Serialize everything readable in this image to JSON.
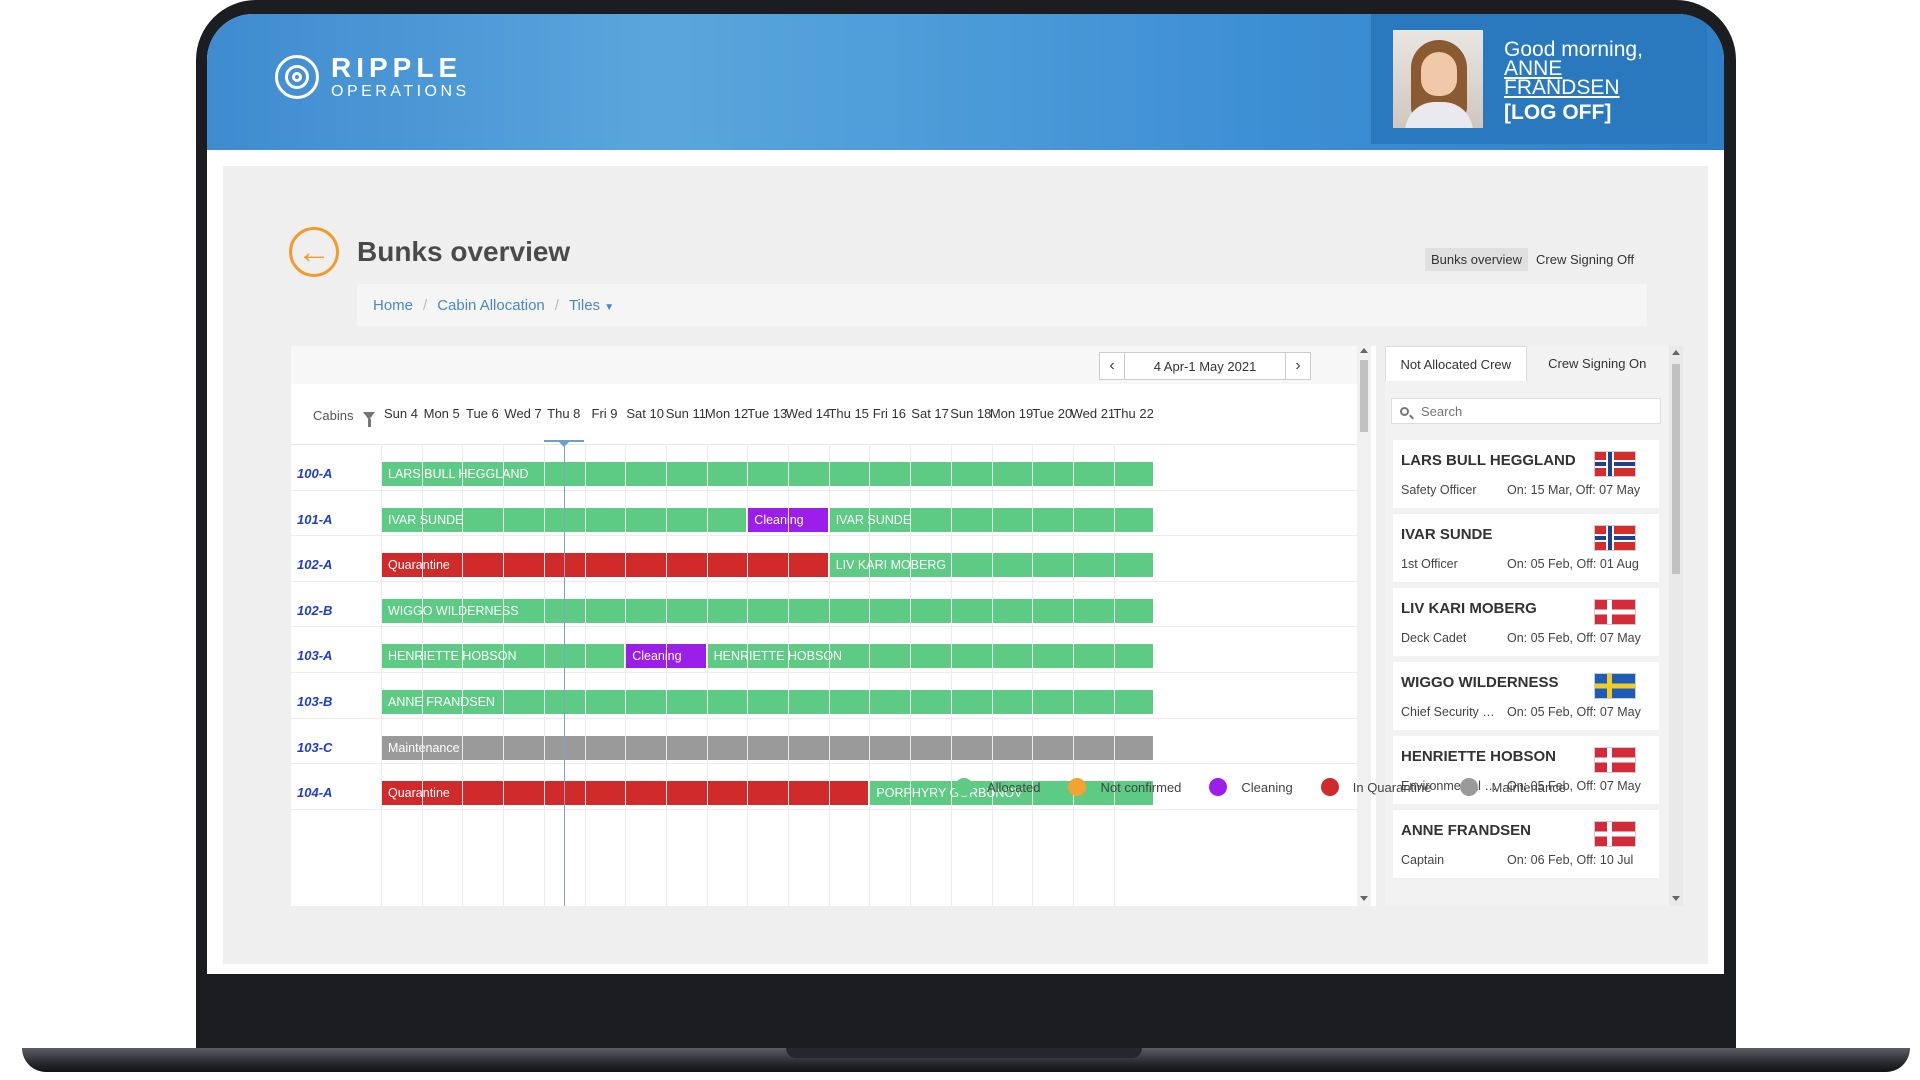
{
  "colors": {
    "allocated": "#5dcb84",
    "not_confirmed": "#f5a233",
    "cleaning": "#9c1eea",
    "quarantine": "#d12a2a",
    "maintenance": "#9a9a9a",
    "accent": "#f39a2c"
  },
  "header": {
    "logo_name": "RIPPLE",
    "logo_sub": "OPERATIONS",
    "greeting": "Good morning,",
    "user_first": "ANNE",
    "user_last": "FRANDSEN",
    "logoff": "[LOG OFF]"
  },
  "page": {
    "title": "Bunks overview",
    "top_links": [
      "Bunks overview",
      "Crew Signing Off"
    ],
    "breadcrumb": [
      "Home",
      "Cabin Allocation",
      "Tiles"
    ]
  },
  "calendar": {
    "range": "4 Apr-1 May 2021",
    "cabins_label": "Cabins",
    "days": [
      "Sun 4",
      "Mon 5",
      "Tue 6",
      "Wed 7",
      "Thu 8",
      "Fri 9",
      "Sat 10",
      "Sun 11",
      "Mon 12",
      "Tue 13",
      "Wed 14",
      "Thu 15",
      "Fri 16",
      "Sat 17",
      "Sun 18",
      "Mon 19",
      "Tue 20",
      "Wed 21",
      "Thu 22"
    ],
    "today_index": 4,
    "rows": [
      {
        "cabin": "100-A",
        "bars": [
          {
            "label": "LARS BULL HEGGLAND",
            "status": "allocated",
            "start": 0,
            "end": 19
          }
        ]
      },
      {
        "cabin": "101-A",
        "bars": [
          {
            "label": "IVAR SUNDE",
            "status": "allocated",
            "start": 0,
            "end": 9
          },
          {
            "label": "Cleaning",
            "status": "cleaning",
            "start": 9,
            "end": 11
          },
          {
            "label": "IVAR SUNDE",
            "status": "allocated",
            "start": 11,
            "end": 19
          }
        ]
      },
      {
        "cabin": "102-A",
        "bars": [
          {
            "label": "Quarantine",
            "status": "quarantine",
            "start": 0,
            "end": 11
          },
          {
            "label": "LIV KARI MOBERG",
            "status": "allocated",
            "start": 11,
            "end": 19
          }
        ]
      },
      {
        "cabin": "102-B",
        "bars": [
          {
            "label": "WIGGO WILDERNESS",
            "status": "allocated",
            "start": 0,
            "end": 19
          }
        ]
      },
      {
        "cabin": "103-A",
        "bars": [
          {
            "label": "HENRIETTE HOBSON",
            "status": "allocated",
            "start": 0,
            "end": 6
          },
          {
            "label": "Cleaning",
            "status": "cleaning",
            "start": 6,
            "end": 8
          },
          {
            "label": "HENRIETTE HOBSON",
            "status": "allocated",
            "start": 8,
            "end": 19
          }
        ]
      },
      {
        "cabin": "103-B",
        "bars": [
          {
            "label": "ANNE FRANDSEN",
            "status": "allocated",
            "start": 0,
            "end": 19
          }
        ]
      },
      {
        "cabin": "103-C",
        "bars": [
          {
            "label": "Maintenance",
            "status": "maintenance",
            "start": 0,
            "end": 19
          }
        ]
      },
      {
        "cabin": "104-A",
        "bars": [
          {
            "label": "Quarantine",
            "status": "quarantine",
            "start": 0,
            "end": 12
          },
          {
            "label": "PORPHYRY GORBUNOV",
            "status": "allocated",
            "start": 12,
            "end": 19
          }
        ]
      }
    ]
  },
  "crew_panel": {
    "tabs": [
      "Not Allocated Crew",
      "Crew Signing On"
    ],
    "search_placeholder": "Search",
    "crew": [
      {
        "name": "LARS BULL HEGGLAND",
        "role": "Safety Officer",
        "dates": "On: 15 Mar, Off: 07 May",
        "flag": "norway"
      },
      {
        "name": "IVAR SUNDE",
        "role": "1st Officer",
        "dates": "On: 05 Feb, Off: 01 Aug",
        "flag": "norway"
      },
      {
        "name": "LIV KARI MOBERG",
        "role": "Deck Cadet",
        "dates": "On: 05 Feb, Off: 07 May",
        "flag": "denmark"
      },
      {
        "name": "WIGGO WILDERNESS",
        "role": "Chief Security Officer",
        "dates": "On: 05 Feb, Off: 07 May",
        "flag": "sweden"
      },
      {
        "name": "HENRIETTE HOBSON",
        "role": "Environmental Coordinator",
        "dates": "On: 05 Feb, Off: 07 May",
        "flag": "denmark"
      },
      {
        "name": "ANNE FRANDSEN",
        "role": "Captain",
        "dates": "On: 06 Feb, Off: 10 Jul",
        "flag": "denmark"
      }
    ]
  },
  "legend": [
    {
      "label": "Allocated",
      "status": "allocated"
    },
    {
      "label": "Not confirmed",
      "status": "not_confirmed"
    },
    {
      "label": "Cleaning",
      "status": "cleaning"
    },
    {
      "label": "In Quarantine",
      "status": "quarantine"
    },
    {
      "label": "Maintenance",
      "status": "maintenance"
    }
  ]
}
